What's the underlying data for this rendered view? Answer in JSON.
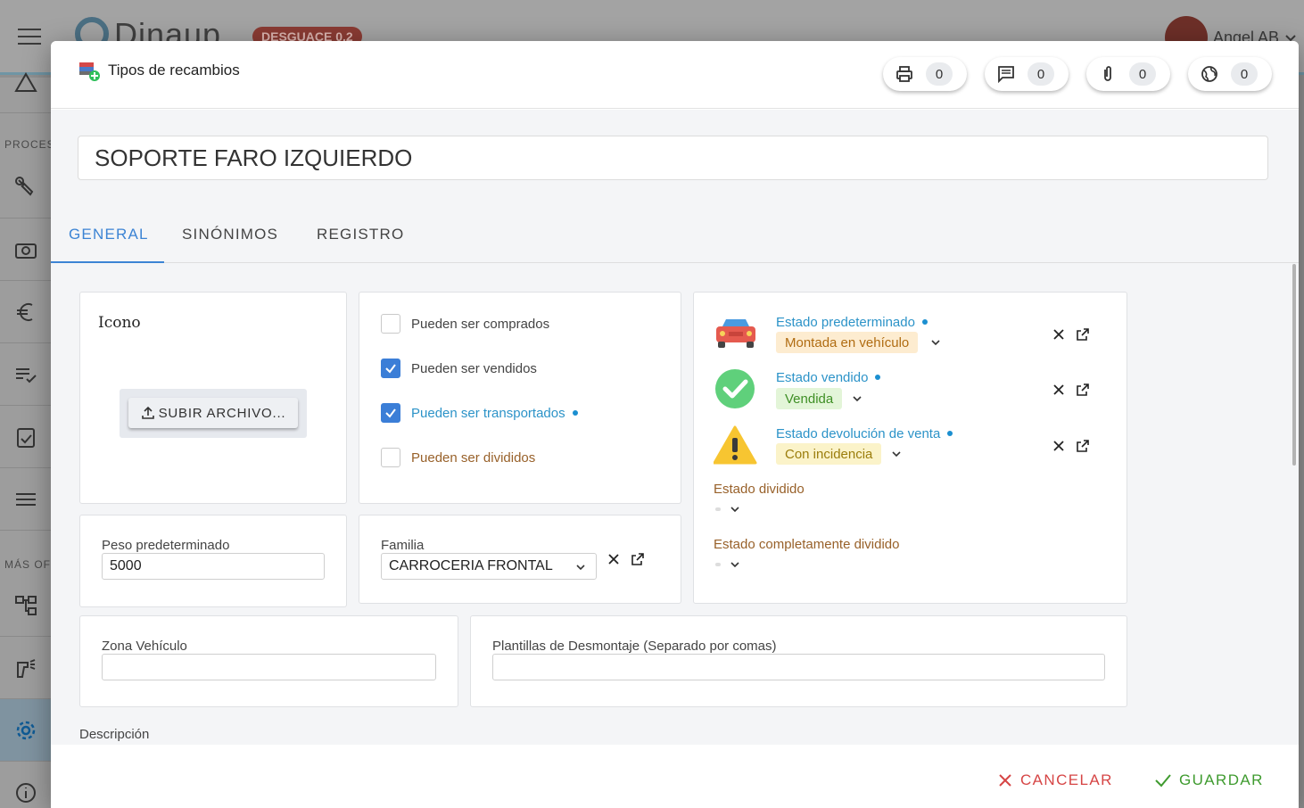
{
  "background": {
    "app_name": "Dinaup",
    "badge": "DESGUACE 0.2",
    "user_name": "Angel AB",
    "sidebar_sections": [
      "PROCES",
      "MÁS OF"
    ]
  },
  "modal": {
    "title": "Tipos de recambios",
    "counters": [
      {
        "icon": "print-icon",
        "count": "0"
      },
      {
        "icon": "comment-icon",
        "count": "0"
      },
      {
        "icon": "attachment-icon",
        "count": "0"
      },
      {
        "icon": "globe-icon",
        "count": "0"
      }
    ],
    "record_name": "SOPORTE FARO IZQUIERDO",
    "tabs": [
      "GENERAL",
      "SINÓNIMOS",
      "REGISTRO"
    ],
    "active_tab": "GENERAL"
  },
  "general": {
    "icon_label": "Icono",
    "upload_label": "SUBIR ARCHIVO...",
    "checkboxes": [
      {
        "label": "Pueden ser comprados",
        "checked": false
      },
      {
        "label": "Pueden ser vendidos",
        "checked": true
      },
      {
        "label": "Pueden ser transportados",
        "checked": true
      },
      {
        "label": "Pueden ser divididos",
        "checked": false
      }
    ],
    "peso_label": "Peso predeterminado",
    "peso_value": "5000",
    "familia_label": "Familia",
    "familia_value": "CARROCERIA FRONTAL",
    "estados": [
      {
        "label": "Estado predeterminado",
        "value": "Montada en vehículo",
        "chip_bg": "#fdecd0",
        "chip_color": "#b06c12",
        "icon": "car-icon"
      },
      {
        "label": "Estado vendido",
        "value": "Vendida",
        "chip_bg": "#e3f5d8",
        "chip_color": "#3f8f25",
        "icon": "check-circle-icon"
      },
      {
        "label": "Estado devolución de venta",
        "value": "Con incidencia",
        "chip_bg": "#fbf3c9",
        "chip_color": "#9b7d0c",
        "icon": "warning-icon"
      }
    ],
    "estado_dividido_label": "Estado dividido",
    "estado_completamente_label": "Estado completamente dividido",
    "zona_label": "Zona Vehículo",
    "zona_value": "",
    "plantillas_label": "Plantillas de Desmontaje (Separado por comas)",
    "plantillas_value": "",
    "descripcion_label": "Descripción"
  },
  "footer": {
    "cancel_label": "CANCELAR",
    "save_label": "GUARDAR"
  },
  "colors": {
    "accent": "#3c84d4",
    "cancel": "#d64545",
    "save": "#3f9b2f",
    "link_blue": "#2c93c8",
    "brown": "#98612a"
  }
}
